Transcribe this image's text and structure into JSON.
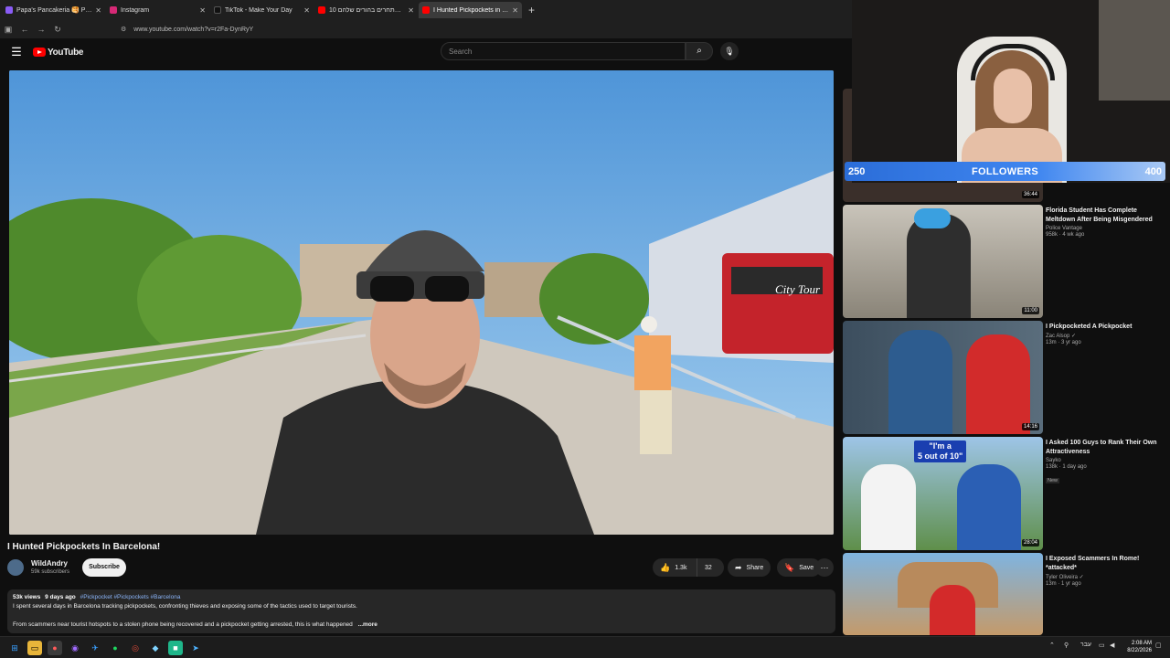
{
  "browser": {
    "tabs": [
      {
        "title": "Papa's Pancakeria 🥞 Play ...",
        "color": "#8a5cf6",
        "active": false
      },
      {
        "title": "Instagram",
        "color": "#d62976",
        "active": false
      },
      {
        "title": "TikTok - Make Your Day",
        "color": "#111111",
        "active": false
      },
      {
        "title": "10 ילדים מתחרים בהורים שלהם",
        "color": "#ff0000",
        "active": false
      },
      {
        "title": "I Hunted Pickpockets in Ba...",
        "color": "#ff0000",
        "active": true
      }
    ],
    "new_tab": "+",
    "url": "www.youtube.com/watch?v=r2Fa-DynRyY"
  },
  "youtube": {
    "logo_text": "YouTube",
    "search_placeholder": "Search"
  },
  "video": {
    "title": "I Hunted Pickpockets In Barcelona!",
    "bus_sign": "City Tour",
    "channel_name": "WildAndry",
    "subscribers": "59k subscribers",
    "subscribe_label": "Subscribe",
    "likes": "1.3k",
    "comments": "32",
    "share_label": "Share",
    "save_label": "Save"
  },
  "description": {
    "views": "53k views",
    "age": "9 days ago",
    "hashtags": "#Pickpocket #Pickpockets #Barcelona",
    "line1": "I spent several days in Barcelona tracking pickpockets, confronting thieves and exposing some of the tactics used to target tourists.",
    "line2": "From scammers near tourist hotspots to a stolen phone being recovered and a pickpocket getting arrested, this is what happened",
    "more": "...more"
  },
  "recommendations": [
    {
      "title": "",
      "channel": "",
      "meta": "",
      "duration": "36:44",
      "thumb_color": "#3a2f2a"
    },
    {
      "title": "Florida Student Has Complete Meltdown After Being Misgendered",
      "channel": "Police Vantage",
      "meta": "958k · 4 wk ago",
      "duration": "11:00",
      "thumb_color": "#9a9387"
    },
    {
      "title": "I Pickpocketed A Pickpocket",
      "channel": "Zac Alsop ✓",
      "meta": "13m · 3 yr ago",
      "duration": "14:16",
      "thumb_color": "#3f5468"
    },
    {
      "title": "I Asked 100 Guys to Rank Their Own Attractiveness",
      "channel": "Sayko",
      "meta": "138k · 1 day ago",
      "badge": "New",
      "duration": "28:04",
      "thumb_color": "#5f8f4a",
      "thumb_text_1": "\"I'm a",
      "thumb_text_2": "5 out of 10\""
    },
    {
      "title": "I Exposed Scammers In Rome! *attacked*",
      "channel": "Tyler Oliveira ✓",
      "meta": "13m · 1 yr ago",
      "duration": "",
      "thumb_color": "#7fb4e0"
    }
  ],
  "stream": {
    "goal_current": "250",
    "goal_label": "FOLLOWERS",
    "goal_target": "400"
  },
  "taskbar": {
    "language": "עבר",
    "time": "2:08 AM",
    "date": "8/22/2026"
  }
}
